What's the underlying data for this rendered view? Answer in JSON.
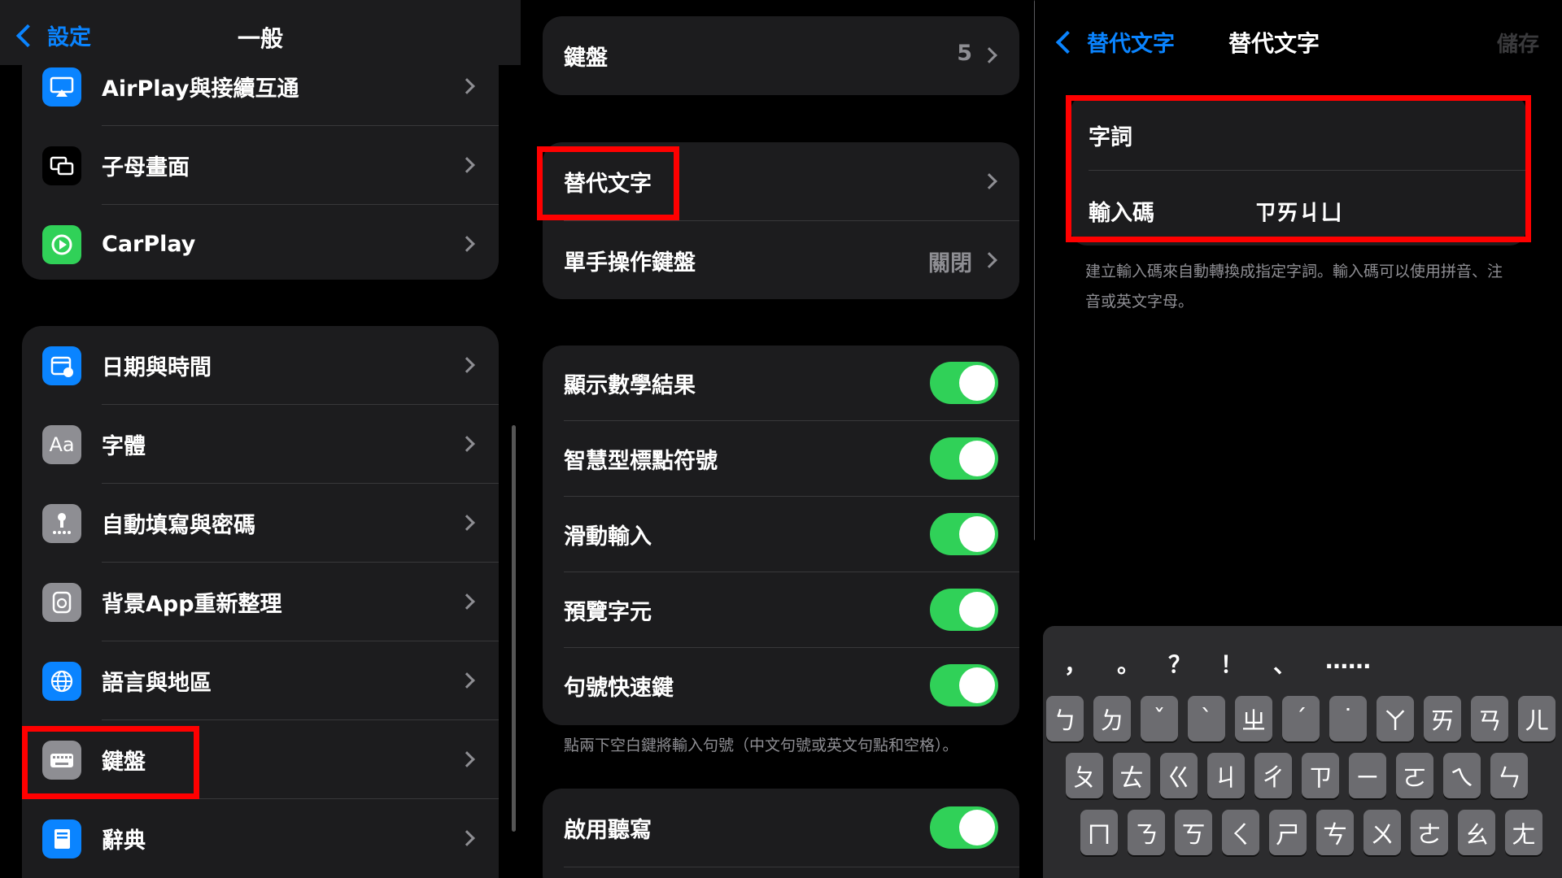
{
  "panel1": {
    "nav": {
      "back": "設定",
      "title": "一般"
    },
    "group1": [
      {
        "label": "AirPlay與接續互通",
        "icon": "airplay-icon",
        "color": "#0a84ff"
      },
      {
        "label": "子母畫面",
        "icon": "picture-in-picture-icon",
        "color": "#000000"
      },
      {
        "label": "CarPlay",
        "icon": "carplay-icon",
        "color": "#30d158"
      }
    ],
    "group2": [
      {
        "label": "日期與時間",
        "icon": "calendar-clock-icon",
        "color": "#0a84ff"
      },
      {
        "label": "字體",
        "icon": "font-icon",
        "glyph": "Aa",
        "color": "#8e8e93"
      },
      {
        "label": "自動填寫與密碼",
        "icon": "key-icon",
        "color": "#8e8e93"
      },
      {
        "label": "背景App重新整理",
        "icon": "refresh-icon",
        "color": "#8e8e93"
      },
      {
        "label": "語言與地區",
        "icon": "globe-icon",
        "color": "#0a84ff"
      },
      {
        "label": "鍵盤",
        "icon": "keyboard-icon",
        "color": "#8e8e93"
      },
      {
        "label": "辭典",
        "icon": "dictionary-icon",
        "color": "#0a84ff"
      }
    ]
  },
  "panel2": {
    "keyboards": {
      "label": "鍵盤",
      "value": "5"
    },
    "group2": [
      {
        "label": "替代文字"
      },
      {
        "label": "單手操作鍵盤",
        "value": "關閉"
      }
    ],
    "toggles": [
      {
        "label": "顯示數學結果",
        "on": true
      },
      {
        "label": "智慧型標點符號",
        "on": true
      },
      {
        "label": "滑動輸入",
        "on": true
      },
      {
        "label": "預覽字元",
        "on": true
      },
      {
        "label": "句號快速鍵",
        "on": true
      }
    ],
    "footnote": "點兩下空白鍵將輸入句號（中文句號或英文句點和空格）。",
    "dictation": {
      "label": "啟用聽寫",
      "on": true
    }
  },
  "panel3": {
    "nav": {
      "back": "替代文字",
      "title": "替代文字",
      "save": "儲存"
    },
    "phrase": {
      "label": "字詞",
      "value": ""
    },
    "shortcut": {
      "label": "輸入碼",
      "value": "ㄗㄞㄐㄩ"
    },
    "description": "建立輸入碼來自動轉換成指定字詞。輸入碼可以使用拼音、注音或英文字母。",
    "candidates": [
      "，",
      "。",
      "？",
      "！",
      "、",
      "……"
    ],
    "keys_row1": [
      "ㄅ",
      "ㄉ",
      "ˇ",
      "ˋ",
      "ㄓ",
      "ˊ",
      "˙",
      "ㄚ",
      "ㄞ",
      "ㄢ",
      "ㄦ"
    ],
    "keys_row2": [
      "ㄆ",
      "ㄊ",
      "ㄍ",
      "ㄐ",
      "ㄔ",
      "ㄗ",
      "ㄧ",
      "ㄛ",
      "ㄟ",
      "ㄣ"
    ],
    "keys_row3": [
      "ㄇ",
      "ㄋ",
      "ㄎ",
      "ㄑ",
      "ㄕ",
      "ㄘ",
      "ㄨ",
      "ㄜ",
      "ㄠ",
      "ㄤ"
    ]
  },
  "colors": {
    "accent": "#0a84ff",
    "toggle_on": "#30d158",
    "highlight": "#ff0000"
  }
}
